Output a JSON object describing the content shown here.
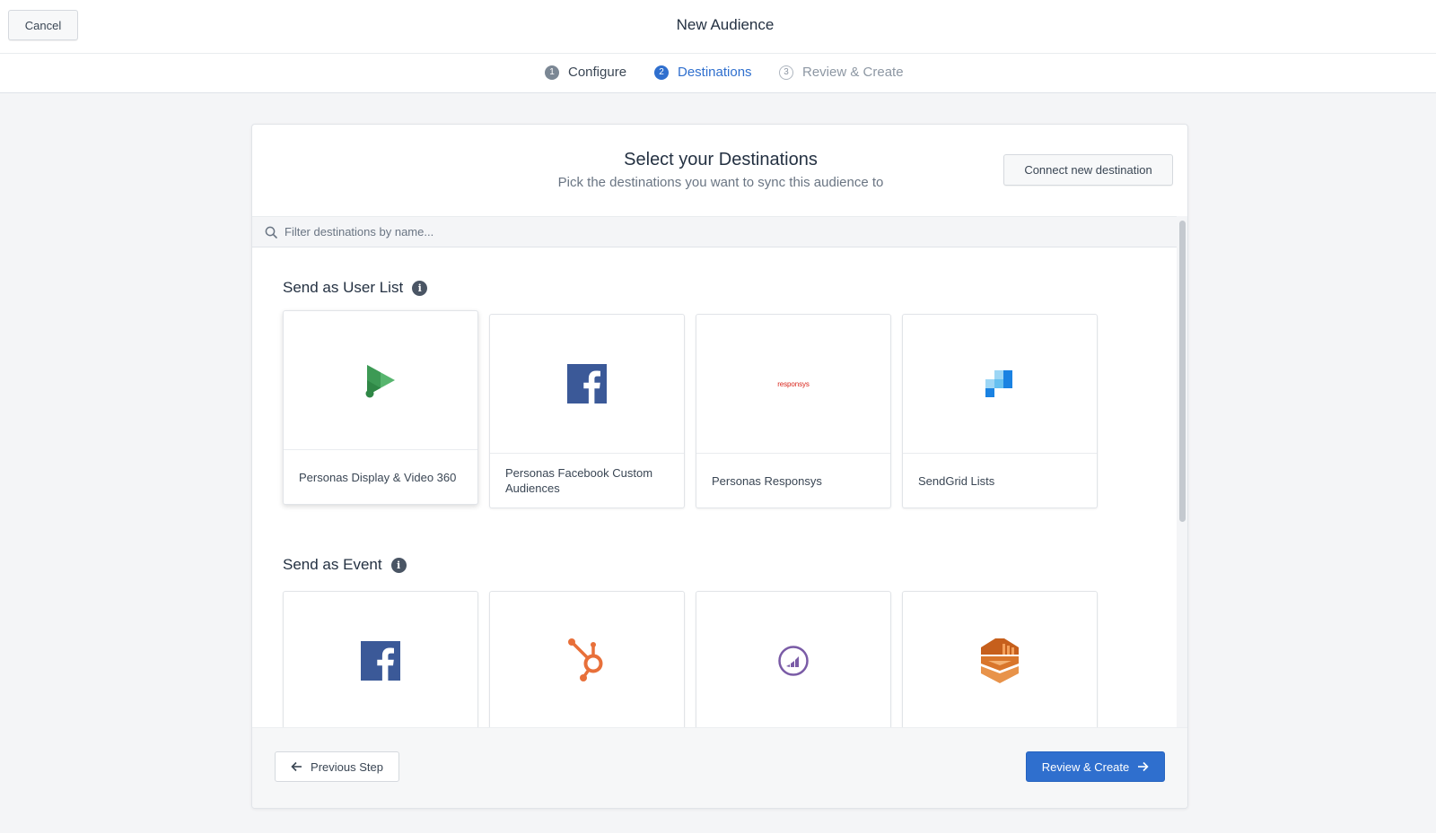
{
  "header": {
    "cancel_label": "Cancel",
    "title": "New Audience"
  },
  "steps": [
    {
      "number": "1",
      "label": "Configure",
      "state": "done"
    },
    {
      "number": "2",
      "label": "Destinations",
      "state": "active"
    },
    {
      "number": "3",
      "label": "Review & Create",
      "state": "pending"
    }
  ],
  "panel": {
    "title": "Select your Destinations",
    "subtitle": "Pick the destinations you want to sync this audience to",
    "connect_label": "Connect new destination",
    "filter_placeholder": "Filter destinations by name...",
    "filter_value": ""
  },
  "user_list": {
    "title": "Send as User List",
    "info_icon": "i",
    "cards": [
      {
        "label": "Personas Display & Video 360",
        "icon": "google-dv360-icon",
        "selected": true
      },
      {
        "label": "Personas Facebook Custom Audiences",
        "icon": "facebook-icon",
        "selected": false
      },
      {
        "label": "Personas Responsys",
        "icon": "responsys-logo",
        "logo_text": "responsys",
        "selected": false
      },
      {
        "label": "SendGrid Lists",
        "icon": "sendgrid-icon",
        "selected": false
      }
    ]
  },
  "event": {
    "title": "Send as Event",
    "info_icon": "i",
    "cards": [
      {
        "label": "",
        "icon": "facebook-icon"
      },
      {
        "label": "",
        "icon": "hubspot-icon"
      },
      {
        "label": "",
        "icon": "marketo-icon"
      },
      {
        "label": "",
        "icon": "amazon-kinesis-icon"
      }
    ]
  },
  "footer": {
    "prev_label": "Previous Step",
    "next_label": "Review & Create"
  },
  "colors": {
    "accent": "#2f6fce",
    "facebook": "#3b5998",
    "hubspot": "#e8703a",
    "marketo": "#7a5ba6",
    "kinesis": "#d9762b"
  }
}
